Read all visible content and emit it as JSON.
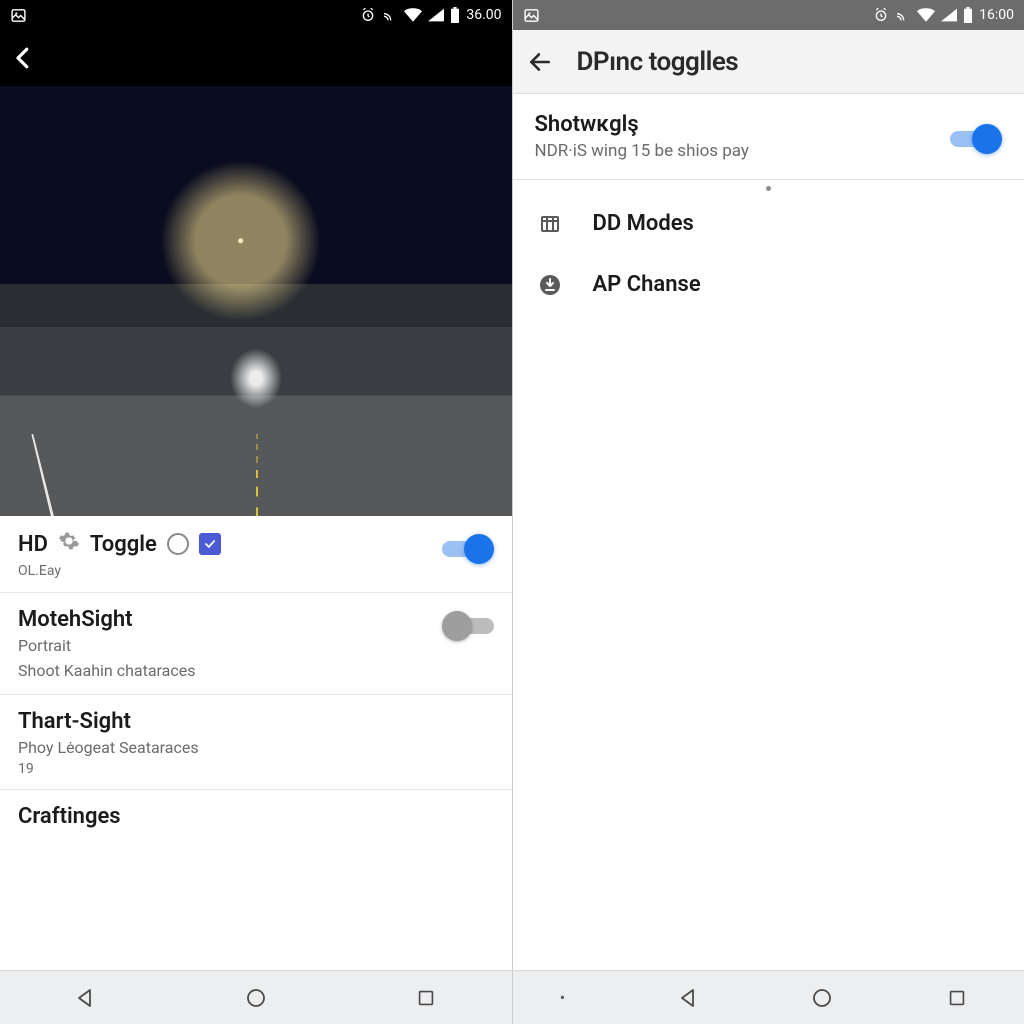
{
  "left": {
    "status": {
      "time": "36.00"
    },
    "settings": {
      "hd_toggle": {
        "title_a": "HD",
        "title_b": "Toggle",
        "sub": "OL.Eay",
        "on": true
      },
      "moteh": {
        "title": "MotehSight",
        "line1": "Portrait",
        "line2": "Shoot Kaahin chataraces",
        "on": false
      },
      "thart": {
        "title": "Thart-Sight",
        "line1": "Phoy Lėogeat Seataraces",
        "line2": "19"
      },
      "craft": {
        "title": "Craftinges"
      }
    }
  },
  "right": {
    "status": {
      "time": "16:00"
    },
    "appbar_title": "DPınc togglles",
    "shot": {
      "title": "Shotwĸglş",
      "sub": "NDR·iS wing 15 be shios pay",
      "on": true
    },
    "items": [
      {
        "icon": "grid",
        "label": "DD Modes"
      },
      {
        "icon": "download",
        "label": "AP Chanse"
      }
    ]
  }
}
